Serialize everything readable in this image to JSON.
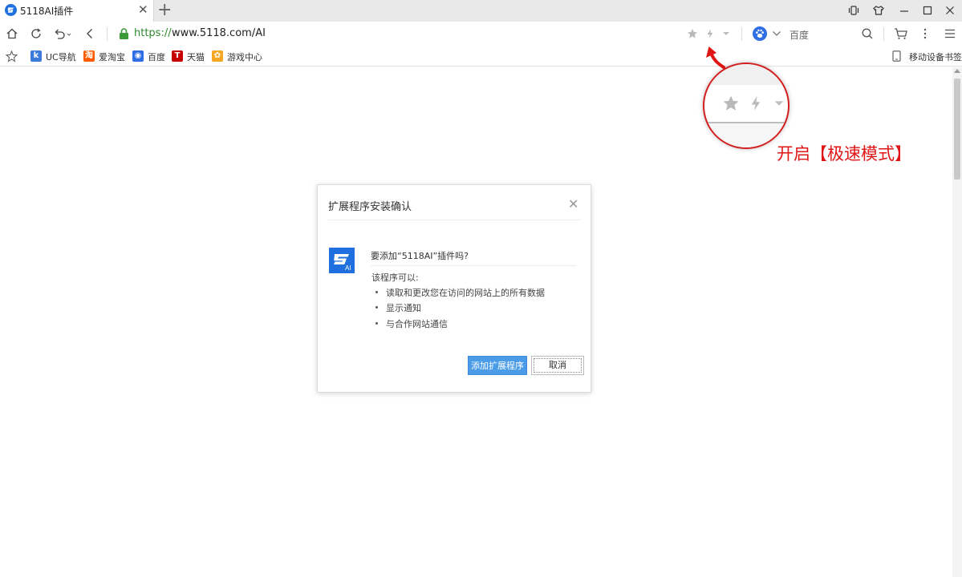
{
  "tab": {
    "title": "5118AI插件",
    "close_icon": "close-icon",
    "new_tab_icon": "plus-icon"
  },
  "window_controls": [
    "vibrate-mode-icon",
    "skin-icon",
    "minimize-icon",
    "maximize-icon",
    "close-icon"
  ],
  "address_bar": {
    "protocol": "https://",
    "host": "www.5118.com/AI",
    "secure_icon": "lock-icon",
    "right_icons": [
      "star-icon",
      "lightning-icon",
      "dropdown-icon"
    ]
  },
  "search": {
    "engine_icon": "baidu-paw-icon",
    "placeholder": "百度"
  },
  "bookmarks": {
    "items": [
      {
        "label": "UC导航",
        "icon": "uc-icon",
        "color": "#3b7bd9"
      },
      {
        "label": "爱淘宝",
        "icon": "taobao-icon",
        "color": "#ff5a00"
      },
      {
        "label": "百度",
        "icon": "baidu-icon",
        "color": "#2f6ee4"
      },
      {
        "label": "天猫",
        "icon": "tmall-icon",
        "color": "#c40000"
      },
      {
        "label": "游戏中心",
        "icon": "game-icon",
        "color": "#f5a623"
      }
    ],
    "mobile_label": "移动设备书签"
  },
  "callout": {
    "text": "开启【极速模式】",
    "color": "#e01515"
  },
  "dialog": {
    "title": "扩展程序安装确认",
    "question": "要添加“5118AI”插件吗?",
    "permissions_heading": "该程序可以:",
    "permissions": [
      "读取和更改您在访问的网站上的所有数据",
      "显示通知",
      "与合作网站通信"
    ],
    "add_button": "添加扩展程序",
    "cancel_button": "取消",
    "accent": "#4a9be8"
  }
}
